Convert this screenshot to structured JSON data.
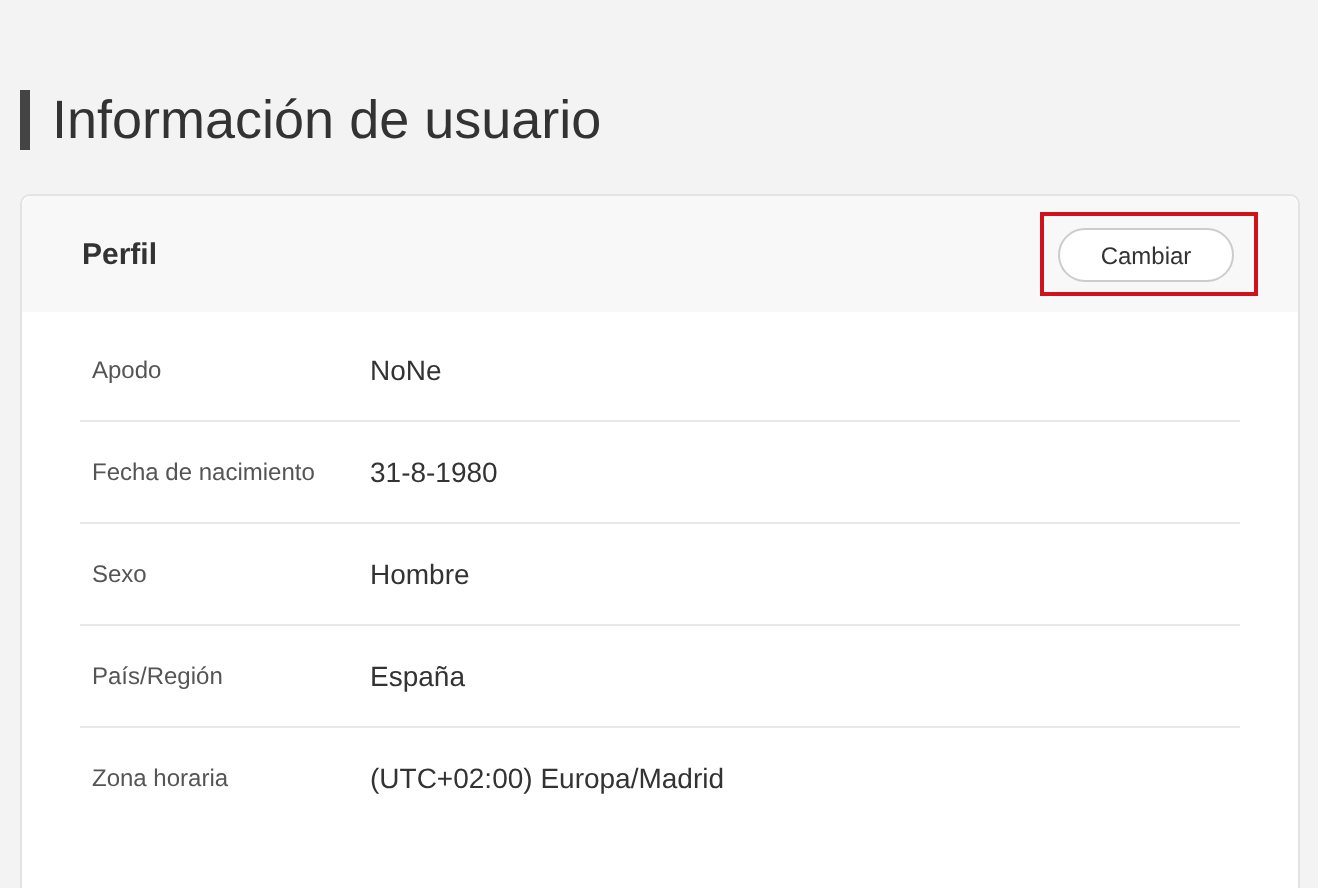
{
  "page_title": "Información de usuario",
  "card": {
    "title": "Perfil",
    "button": {
      "label": "Cambiar",
      "highlighted": true
    },
    "rows": [
      {
        "label": "Apodo",
        "value": "NoNe"
      },
      {
        "label": "Fecha de nacimiento",
        "value": "31-8-1980"
      },
      {
        "label": "Sexo",
        "value": "Hombre"
      },
      {
        "label": "País/Región",
        "value": "España"
      },
      {
        "label": "Zona horaria",
        "value": "(UTC+02:00) Europa/Madrid"
      }
    ]
  }
}
